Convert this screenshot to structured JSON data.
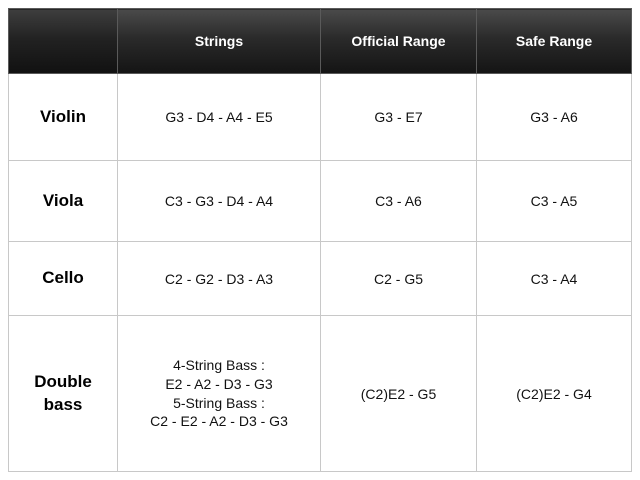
{
  "header": {
    "strings": "Strings",
    "official_range": "Official Range",
    "safe_range": "Safe Range"
  },
  "rows": [
    {
      "instrument": "Violin",
      "strings": "G3 - D4 - A4 - E5",
      "official": "G3 - E7",
      "safe": "G3 - A6"
    },
    {
      "instrument": "Viola",
      "strings": "C3 - G3 - D4 - A4",
      "official": "C3 - A6",
      "safe": "C3 - A5"
    },
    {
      "instrument": "Cello",
      "strings": "C2 - G2 - D3 - A3",
      "official": "C2 - G5",
      "safe": "C3 - A4"
    },
    {
      "instrument_line1": "Double",
      "instrument_line2": "bass",
      "strings_lines": [
        "4-String Bass :",
        "E2 - A2 - D3 - G3",
        "5-String Bass :",
        "C2 - E2 - A2 - D3 - G3"
      ],
      "official": "(C2)E2 - G5",
      "safe": "(C2)E2 - G4"
    }
  ]
}
